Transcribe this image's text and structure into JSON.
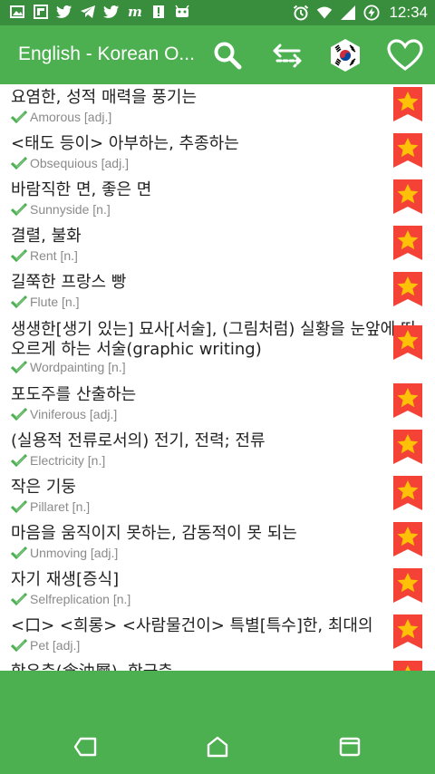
{
  "status_bar": {
    "time": "12:34",
    "left_icons": [
      "image-icon",
      "flipboard-icon",
      "twitter-icon",
      "telegram-icon",
      "twitter-icon",
      "m-icon",
      "alert-icon",
      "android-icon"
    ],
    "right_icons": [
      "alarm-icon",
      "wifi-icon",
      "signal-icon",
      "battery-icon"
    ]
  },
  "app_bar": {
    "title": "English - Korean O...",
    "search_icon": "search-icon",
    "swap_icon": "swap-icon",
    "flag_icon": "korea-flag-icon",
    "favorite_icon": "heart-icon"
  },
  "entries": [
    {
      "ko": "요염한, 성적 매력을 풍기는",
      "en": "Amorous [adj.]"
    },
    {
      "ko": "<태도 등이> 아부하는, 추종하는",
      "en": "Obsequious [adj.]"
    },
    {
      "ko": "바람직한 면, 좋은 면",
      "en": "Sunnyside [n.]"
    },
    {
      "ko": "결렬, 불화",
      "en": "Rent [n.]"
    },
    {
      "ko": "길쭉한 프랑스 빵",
      "en": "Flute [n.]"
    },
    {
      "ko": "생생한[생기 있는] 묘사[서술], (그림처럼) 실황을 눈앞에 떠오르게 하는 서술(graphic writing)",
      "en": "Wordpainting [n.]"
    },
    {
      "ko": "포도주를 산출하는",
      "en": "Viniferous [adj.]"
    },
    {
      "ko": "(실용적 전류로서의) 전기, 전력; 전류",
      "en": "Electricity [n.]"
    },
    {
      "ko": "작은 기둥",
      "en": "Pillaret [n.]"
    },
    {
      "ko": "마음을 움직이지 못하는, 감동적이 못 되는",
      "en": "Unmoving [adj.]"
    },
    {
      "ko": "자기 재생[증식]",
      "en": "Selfreplication [n.]"
    },
    {
      "ko": "<口> <희롱> <사람물건이> 특별[특수]한, 최대의",
      "en": "Pet [adj.]"
    },
    {
      "ko": "함유층(含油層), 함균층",
      "en": ""
    }
  ],
  "colors": {
    "status_bar": "#388e3c",
    "app_bar": "#4caf50",
    "bookmark_red": "#f44336",
    "bookmark_star": "#ffc107",
    "check_green": "#4caf50"
  },
  "nav": {
    "back_icon": "back-icon",
    "home_icon": "home-icon",
    "recents_icon": "recents-icon"
  }
}
